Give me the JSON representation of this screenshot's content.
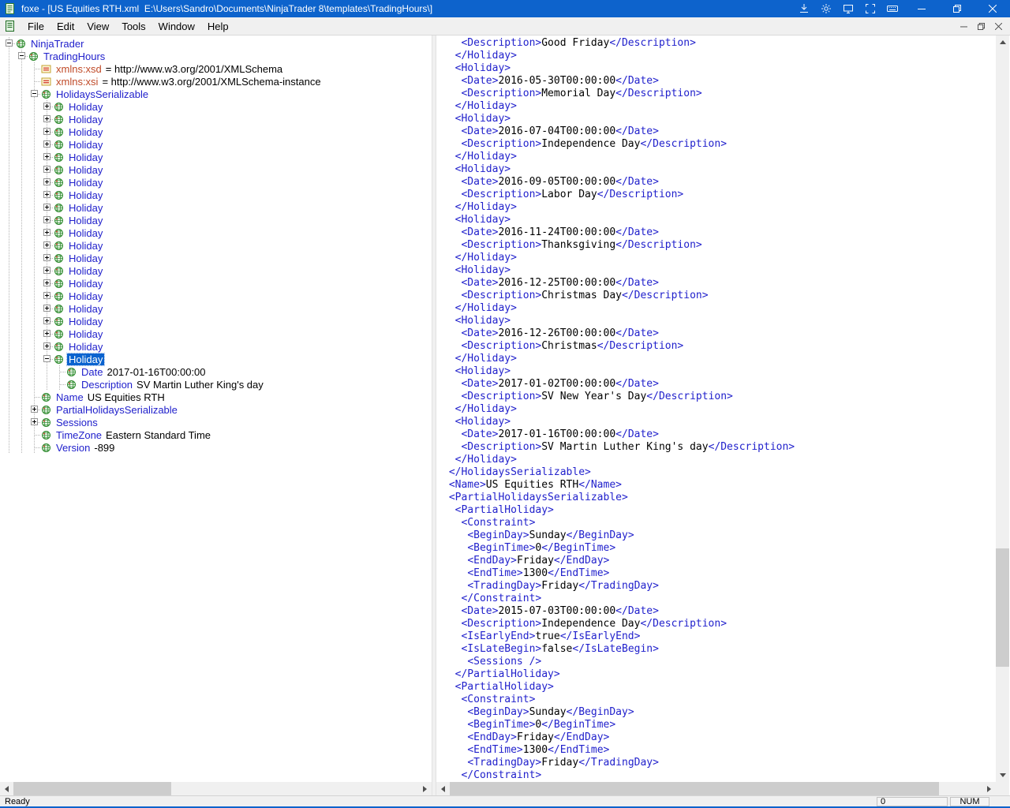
{
  "window": {
    "title": "foxe - [US Equities RTH.xml  E:\\Users\\Sandro\\Documents\\NinjaTrader 8\\templates\\TradingHours\\]"
  },
  "titlebar": {
    "tool_icons": [
      "fit-to-screen",
      "settings-gear",
      "display",
      "fullscreen",
      "keyboard"
    ],
    "window_controls": [
      "minimize",
      "restore",
      "close"
    ]
  },
  "menu": {
    "items": [
      "File",
      "Edit",
      "View",
      "Tools",
      "Window",
      "Help"
    ],
    "window_controls": [
      "minimize",
      "restore",
      "close"
    ]
  },
  "colors": {
    "titlebar": "#0d63cc",
    "tag": "#2121cc",
    "attribute": "#c04a28",
    "selection": "#0a63cf"
  },
  "tree": {
    "nodes": [
      {
        "level": 0,
        "expand": "minus",
        "icon": "element",
        "label": "NinjaTrader"
      },
      {
        "level": 1,
        "expand": "minus",
        "icon": "element",
        "label": "TradingHours"
      },
      {
        "level": 2,
        "expand": null,
        "icon": "attribute",
        "label": "xmlns:xsd",
        "value": "= http://www.w3.org/2001/XMLSchema"
      },
      {
        "level": 2,
        "expand": null,
        "icon": "attribute",
        "label": "xmlns:xsi",
        "value": "= http://www.w3.org/2001/XMLSchema-instance"
      },
      {
        "level": 2,
        "expand": "minus",
        "icon": "element",
        "label": "HolidaysSerializable"
      },
      {
        "level": 3,
        "expand": "plus",
        "icon": "element",
        "label": "Holiday"
      },
      {
        "level": 3,
        "expand": "plus",
        "icon": "element",
        "label": "Holiday"
      },
      {
        "level": 3,
        "expand": "plus",
        "icon": "element",
        "label": "Holiday"
      },
      {
        "level": 3,
        "expand": "plus",
        "icon": "element",
        "label": "Holiday"
      },
      {
        "level": 3,
        "expand": "plus",
        "icon": "element",
        "label": "Holiday"
      },
      {
        "level": 3,
        "expand": "plus",
        "icon": "element",
        "label": "Holiday"
      },
      {
        "level": 3,
        "expand": "plus",
        "icon": "element",
        "label": "Holiday"
      },
      {
        "level": 3,
        "expand": "plus",
        "icon": "element",
        "label": "Holiday"
      },
      {
        "level": 3,
        "expand": "plus",
        "icon": "element",
        "label": "Holiday"
      },
      {
        "level": 3,
        "expand": "plus",
        "icon": "element",
        "label": "Holiday"
      },
      {
        "level": 3,
        "expand": "plus",
        "icon": "element",
        "label": "Holiday"
      },
      {
        "level": 3,
        "expand": "plus",
        "icon": "element",
        "label": "Holiday"
      },
      {
        "level": 3,
        "expand": "plus",
        "icon": "element",
        "label": "Holiday"
      },
      {
        "level": 3,
        "expand": "plus",
        "icon": "element",
        "label": "Holiday"
      },
      {
        "level": 3,
        "expand": "plus",
        "icon": "element",
        "label": "Holiday"
      },
      {
        "level": 3,
        "expand": "plus",
        "icon": "element",
        "label": "Holiday"
      },
      {
        "level": 3,
        "expand": "plus",
        "icon": "element",
        "label": "Holiday"
      },
      {
        "level": 3,
        "expand": "plus",
        "icon": "element",
        "label": "Holiday"
      },
      {
        "level": 3,
        "expand": "plus",
        "icon": "element",
        "label": "Holiday"
      },
      {
        "level": 3,
        "expand": "plus",
        "icon": "element",
        "label": "Holiday"
      },
      {
        "level": 3,
        "expand": "minus",
        "icon": "element",
        "label": "Holiday",
        "selected": true
      },
      {
        "level": 4,
        "expand": null,
        "icon": "element",
        "label": "Date",
        "value": "2017-01-16T00:00:00"
      },
      {
        "level": 4,
        "expand": null,
        "icon": "element",
        "label": "Description",
        "value": "SV Martin Luther King's day"
      },
      {
        "level": 2,
        "expand": null,
        "icon": "element",
        "label": "Name",
        "value": "US Equities RTH"
      },
      {
        "level": 2,
        "expand": "plus",
        "icon": "element",
        "label": "PartialHolidaysSerializable"
      },
      {
        "level": 2,
        "expand": "plus",
        "icon": "element",
        "label": "Sessions"
      },
      {
        "level": 2,
        "expand": null,
        "icon": "element",
        "label": "TimeZone",
        "value": "Eastern Standard Time"
      },
      {
        "level": 2,
        "expand": null,
        "icon": "element",
        "label": "Version",
        "value": "-899"
      }
    ]
  },
  "editor": {
    "lines": [
      "   <Description>Good Friday</Description>",
      "  </Holiday>",
      "  <Holiday>",
      "   <Date>2016-05-30T00:00:00</Date>",
      "   <Description>Memorial Day</Description>",
      "  </Holiday>",
      "  <Holiday>",
      "   <Date>2016-07-04T00:00:00</Date>",
      "   <Description>Independence Day</Description>",
      "  </Holiday>",
      "  <Holiday>",
      "   <Date>2016-09-05T00:00:00</Date>",
      "   <Description>Labor Day</Description>",
      "  </Holiday>",
      "  <Holiday>",
      "   <Date>2016-11-24T00:00:00</Date>",
      "   <Description>Thanksgiving</Description>",
      "  </Holiday>",
      "  <Holiday>",
      "   <Date>2016-12-25T00:00:00</Date>",
      "   <Description>Christmas Day</Description>",
      "  </Holiday>",
      "  <Holiday>",
      "   <Date>2016-12-26T00:00:00</Date>",
      "   <Description>Christmas</Description>",
      "  </Holiday>",
      "  <Holiday>",
      "   <Date>2017-01-02T00:00:00</Date>",
      "   <Description>SV New Year's Day</Description>",
      "  </Holiday>",
      "  <Holiday>",
      "   <Date>2017-01-16T00:00:00</Date>",
      "   <Description>SV Martin Luther King's day</Description>",
      "  </Holiday>",
      " </HolidaysSerializable>",
      " <Name>US Equities RTH</Name>",
      " <PartialHolidaysSerializable>",
      "  <PartialHoliday>",
      "   <Constraint>",
      "    <BeginDay>Sunday</BeginDay>",
      "    <BeginTime>0</BeginTime>",
      "    <EndDay>Friday</EndDay>",
      "    <EndTime>1300</EndTime>",
      "    <TradingDay>Friday</TradingDay>",
      "   </Constraint>",
      "   <Date>2015-07-03T00:00:00</Date>",
      "   <Description>Independence Day</Description>",
      "   <IsEarlyEnd>true</IsEarlyEnd>",
      "   <IsLateBegin>false</IsLateBegin>",
      "    <Sessions />",
      "  </PartialHoliday>",
      "  <PartialHoliday>",
      "   <Constraint>",
      "    <BeginDay>Sunday</BeginDay>",
      "    <BeginTime>0</BeginTime>",
      "    <EndDay>Friday</EndDay>",
      "    <EndTime>1300</EndTime>",
      "    <TradingDay>Friday</TradingDay>",
      "   </Constraint>"
    ]
  },
  "statusbar": {
    "ready": "Ready",
    "value": "0",
    "num": "NUM"
  }
}
